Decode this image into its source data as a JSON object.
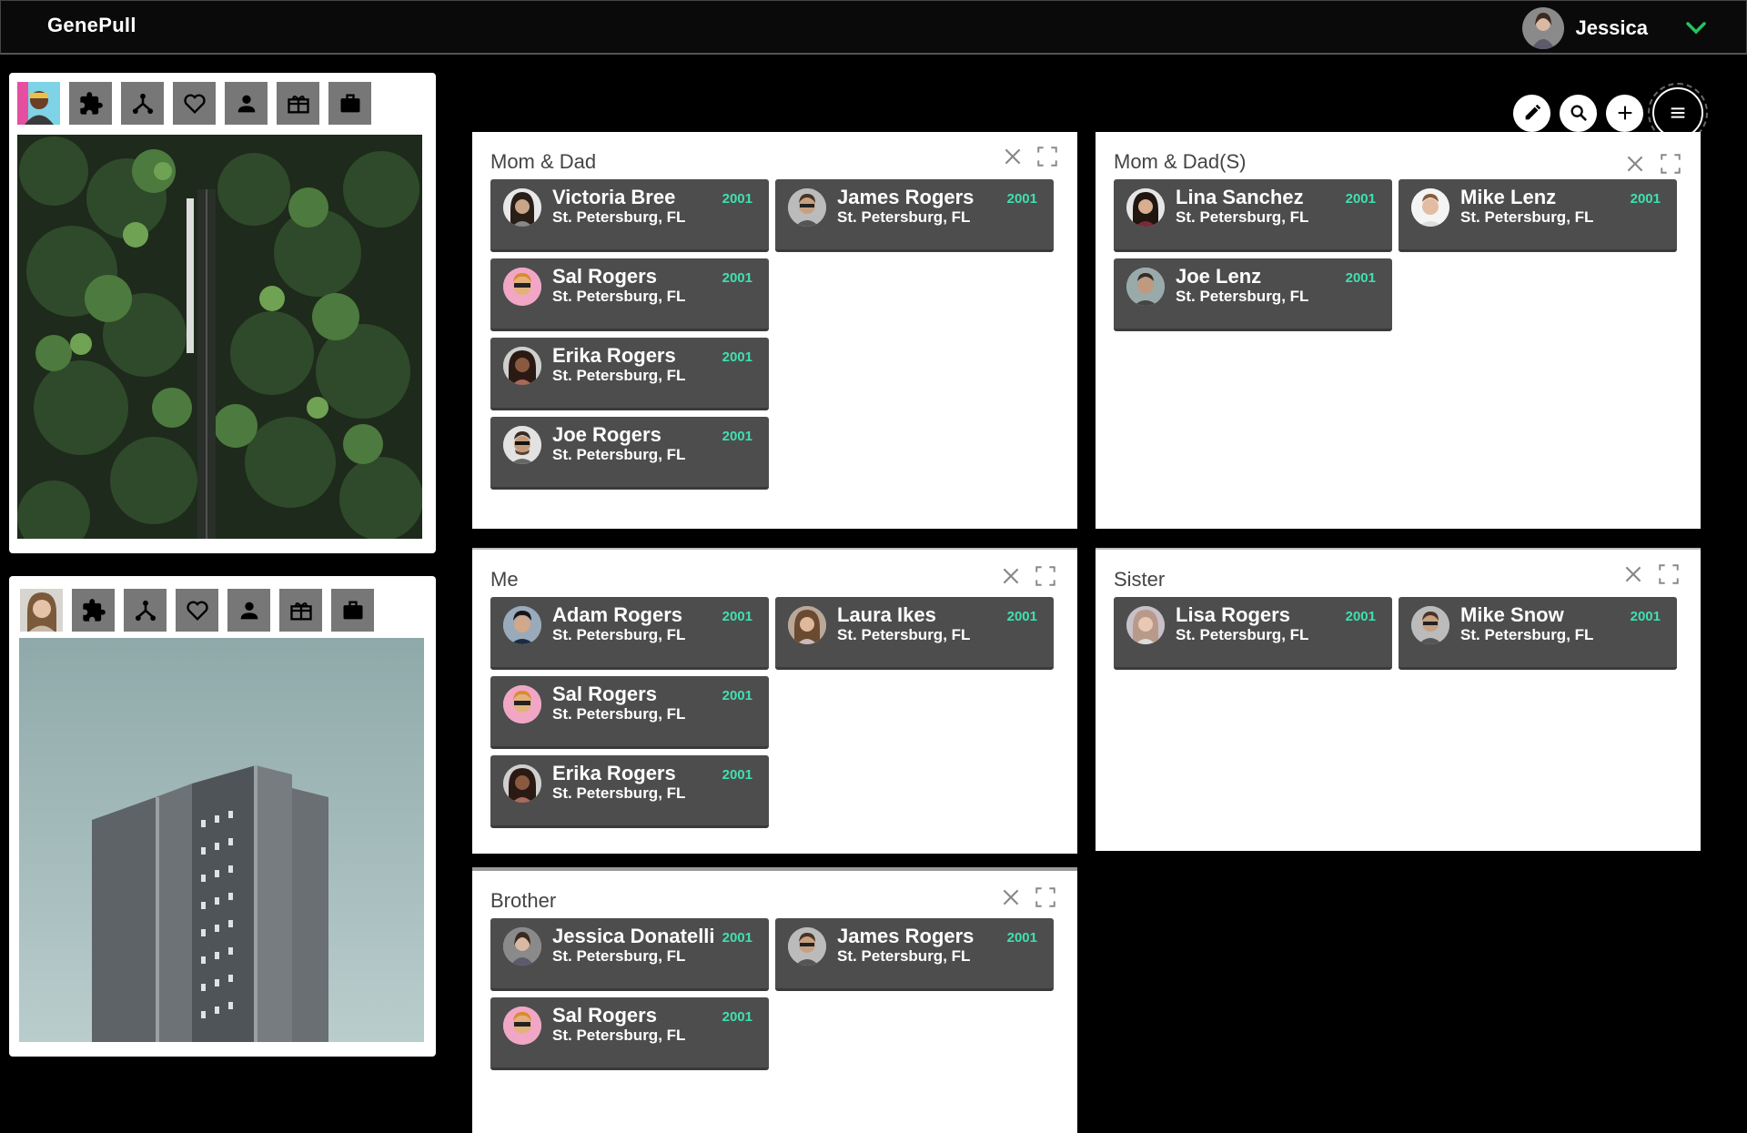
{
  "app": {
    "brand": "GenePull"
  },
  "user": {
    "name": "Jessica"
  },
  "cards": [
    {
      "icons": [
        "avatar",
        "puzzle-icon",
        "tree-icon",
        "heart-icon",
        "person-icon",
        "gift-icon",
        "briefcase-icon"
      ],
      "photo": "forest-road"
    },
    {
      "icons": [
        "avatar",
        "puzzle-icon",
        "tree-icon",
        "heart-icon",
        "person-icon",
        "gift-icon",
        "briefcase-icon"
      ],
      "photo": "tower-building"
    }
  ],
  "actions": [
    "edit-icon",
    "search-icon",
    "plus-icon",
    "menu-icon"
  ],
  "panels": [
    {
      "title": "Mom & Dad",
      "people": [
        {
          "name": "Victoria Bree",
          "location": "St. Petersburg, FL",
          "year": "2001"
        },
        {
          "name": "James Rogers",
          "location": "St. Petersburg, FL",
          "year": "2001"
        },
        {
          "name": "Sal Rogers",
          "location": "St. Petersburg, FL",
          "year": "2001"
        },
        {
          "name": "Erika Rogers",
          "location": "St. Petersburg, FL",
          "year": "2001"
        },
        {
          "name": "Joe Rogers",
          "location": "St. Petersburg, FL",
          "year": "2001"
        }
      ]
    },
    {
      "title": "Mom & Dad(S)",
      "people": [
        {
          "name": "Lina Sanchez",
          "location": "St. Petersburg, FL",
          "year": "2001"
        },
        {
          "name": "Mike Lenz",
          "location": "St. Petersburg, FL",
          "year": "2001"
        },
        {
          "name": "Joe Lenz",
          "location": "St. Petersburg, FL",
          "year": "2001"
        }
      ]
    },
    {
      "title": "Me",
      "people": [
        {
          "name": "Adam Rogers",
          "location": "St. Petersburg, FL",
          "year": "2001"
        },
        {
          "name": "Laura Ikes",
          "location": "St. Petersburg, FL",
          "year": "2001"
        },
        {
          "name": "Sal Rogers",
          "location": "St. Petersburg, FL",
          "year": "2001"
        },
        {
          "name": "Erika Rogers",
          "location": "St. Petersburg, FL",
          "year": "2001"
        }
      ]
    },
    {
      "title": "Sister",
      "people": [
        {
          "name": "Lisa Rogers",
          "location": "St. Petersburg, FL",
          "year": "2001"
        },
        {
          "name": "Mike Snow",
          "location": "St. Petersburg, FL",
          "year": "2001"
        }
      ]
    },
    {
      "title": "Brother",
      "people": [
        {
          "name": "Jessica Donatelli",
          "location": "St. Petersburg, FL",
          "year": "2001"
        },
        {
          "name": "James Rogers",
          "location": "St. Petersburg, FL",
          "year": "2001"
        },
        {
          "name": "Sal Rogers",
          "location": "St. Petersburg, FL",
          "year": "2001"
        }
      ]
    }
  ],
  "colors": {
    "accent": "#3fe0b0",
    "cardGray": "#4d4d4d",
    "chevron": "#22c55e"
  }
}
